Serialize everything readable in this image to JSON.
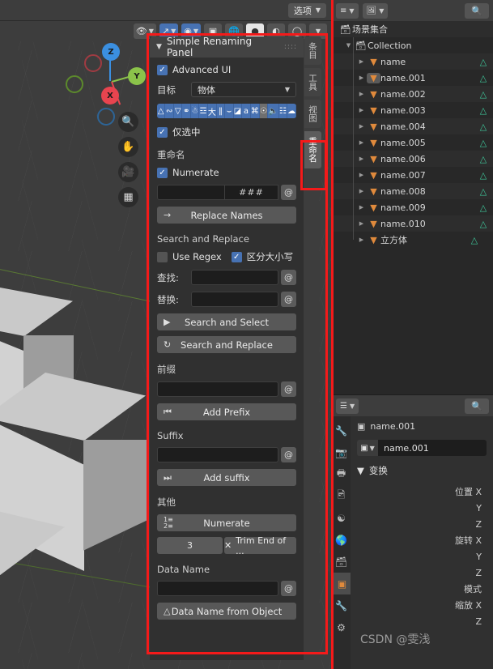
{
  "viewport": {
    "options_button": "选项",
    "gizmo_axes": [
      {
        "label": "Z",
        "color": "#3b8fe0"
      },
      {
        "label": "Y",
        "color": "#8bc34a"
      },
      {
        "label": "X",
        "color": "#e8444f"
      }
    ],
    "tools": [
      "zoom-icon",
      "hand-icon",
      "camera-icon",
      "grid-icon"
    ],
    "header_toggles": [
      "visibility-icon",
      "snap-icon",
      "proportional-edit-icon",
      "overlay-icon",
      "wireframe-shading-icon",
      "solid-shading-icon",
      "material-shading-icon",
      "rendered-shading-icon"
    ]
  },
  "panel": {
    "title": "Simple Renaming Panel",
    "advanced_ui": {
      "label": "Advanced UI",
      "checked": true
    },
    "target": {
      "label": "目标",
      "value": "物体"
    },
    "only_selected": {
      "label": "仅选中",
      "checked": true
    },
    "rename_section": "重命名",
    "numerate": {
      "label": "Numerate",
      "checked": true
    },
    "numerate_field": {
      "value": "",
      "suffix": "###"
    },
    "replace_names_button": "Replace Names",
    "search_replace_section": "Search and Replace",
    "use_regex": {
      "label": "Use Regex",
      "checked": false
    },
    "match_case": {
      "label": "区分大小写",
      "checked": true
    },
    "find": {
      "label": "查找:",
      "value": ""
    },
    "replace": {
      "label": "替换:",
      "value": ""
    },
    "search_and_select_button": "Search and Select",
    "search_and_replace_button": "Search and Replace",
    "prefix_section": "前缀",
    "prefix_field": "",
    "add_prefix_button": "Add Prefix",
    "suffix_section": "Suffix",
    "suffix_field": "",
    "add_suffix_button": "Add suffix",
    "other_section": "其他",
    "numerate_button": "Numerate",
    "trim_count": "3",
    "trim_button": "Trim End of ...",
    "data_name_section": "Data Name",
    "data_name_field": "",
    "data_name_from_object_button": "Data Name from Object",
    "at_symbol": "@"
  },
  "vertical_tabs": [
    {
      "label": "条目",
      "active": false
    },
    {
      "label": "工具",
      "active": false
    },
    {
      "label": "视图",
      "active": false
    },
    {
      "label": "重命名",
      "active": true
    }
  ],
  "outliner": {
    "scene_collection": "场景集合",
    "collection": "Collection",
    "items": [
      {
        "name": "name",
        "selected": false,
        "has_mesh": true
      },
      {
        "name": "name.001",
        "selected": true,
        "has_mesh": true
      },
      {
        "name": "name.002",
        "selected": false,
        "has_mesh": true
      },
      {
        "name": "name.003",
        "selected": false,
        "has_mesh": true
      },
      {
        "name": "name.004",
        "selected": false,
        "has_mesh": true
      },
      {
        "name": "name.005",
        "selected": false,
        "has_mesh": true
      },
      {
        "name": "name.006",
        "selected": false,
        "has_mesh": true
      },
      {
        "name": "name.007",
        "selected": false,
        "has_mesh": true
      },
      {
        "name": "name.008",
        "selected": false,
        "has_mesh": true
      },
      {
        "name": "name.009",
        "selected": false,
        "has_mesh": true
      },
      {
        "name": "name.010",
        "selected": false,
        "has_mesh": true
      },
      {
        "name": "立方体",
        "selected": false,
        "has_mesh": true
      }
    ]
  },
  "properties": {
    "breadcrumb": "name.001",
    "object_name": "name.001",
    "transform_section": "变换",
    "fields": [
      "位置 X",
      "Y",
      "Z",
      "旋转 X",
      "Y",
      "Z",
      "模式",
      "缩放 X",
      "Z"
    ]
  },
  "watermark": "CSDN @雯浅",
  "colors": {
    "accent_blue": "#4772b3",
    "highlight_red": "#f41a1a",
    "mesh_green": "#3ec79a",
    "object_orange": "#e08a3c"
  }
}
